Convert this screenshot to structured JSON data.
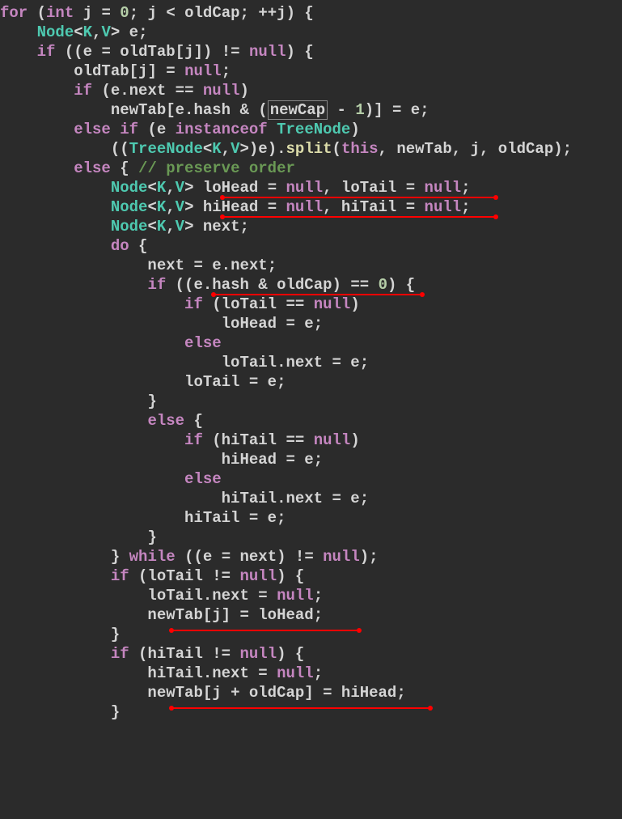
{
  "code": {
    "line1": "for (int j = 0; j < oldCap; ++j) {",
    "line2": "    Node<K,V> e;",
    "line3": "    if ((e = oldTab[j]) != null) {",
    "line4": "        oldTab[j] = null;",
    "line5": "        if (e.next == null)",
    "line6": "            newTab[e.hash & (newCap - 1)] = e;",
    "line7": "        else if (e instanceof TreeNode)",
    "line8": "            ((TreeNode<K,V>)e).split(this, newTab, j, oldCap);",
    "line9": "        else { // preserve order",
    "line10": "            Node<K,V> loHead = null, loTail = null;",
    "line11": "            Node<K,V> hiHead = null, hiTail = null;",
    "line12": "            Node<K,V> next;",
    "line13": "            do {",
    "line14": "                next = e.next;",
    "line15": "                if ((e.hash & oldCap) == 0) {",
    "line16": "                    if (loTail == null)",
    "line17": "                        loHead = e;",
    "line18": "                    else",
    "line19": "                        loTail.next = e;",
    "line20": "                    loTail = e;",
    "line21": "                }",
    "line22": "                else {",
    "line23": "                    if (hiTail == null)",
    "line24": "                        hiHead = e;",
    "line25": "                    else",
    "line26": "                        hiTail.next = e;",
    "line27": "                    hiTail = e;",
    "line28": "                }",
    "line29": "            } while ((e = next) != null);",
    "line30": "            if (loTail != null) {",
    "line31": "                loTail.next = null;",
    "line32": "                newTab[j] = loHead;",
    "line33": "            }",
    "line34": "            if (hiTail != null) {",
    "line35": "                hiTail.next = null;",
    "line36": "                newTab[j + oldCap] = hiHead;",
    "line37": "            }"
  },
  "annotations": {
    "underlines": [
      "loHead = null, loTail = null;",
      "hiHead = null, hiTail = null;",
      "(e.hash & oldCap) == 0",
      "newTab[j] = loHead;  }",
      "newTab[j + oldCap] = hiHead;  }"
    ],
    "boxed": "newCap"
  },
  "colors": {
    "background": "#2b2b2b",
    "keyword": "#c586c0",
    "type": "#4ec9b0",
    "number": "#b5cea8",
    "default": "#d4d4d4",
    "comment": "#6a9955",
    "method": "#dcdcaa",
    "underline": "#ff0000"
  }
}
